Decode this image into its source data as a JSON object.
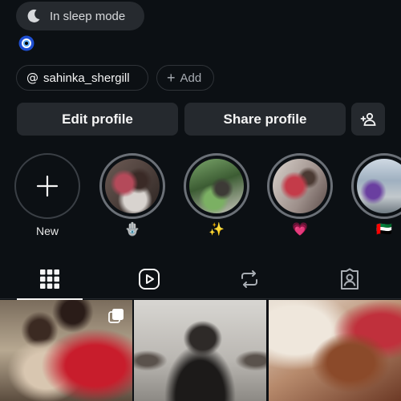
{
  "status": {
    "text": "In sleep mode",
    "icon": "moon-icon"
  },
  "bio_emoji": {
    "icon": "evil-eye-icon"
  },
  "links": {
    "threads_handle": "sahinka_shergill",
    "add_label": "Add"
  },
  "actions": {
    "edit_label": "Edit profile",
    "share_label": "Share profile",
    "add_friend_icon": "person-add-icon"
  },
  "highlights": {
    "new_label": "New",
    "items": [
      {
        "label": "🪬",
        "icon": "hamsa-emoji"
      },
      {
        "label": "✨",
        "icon": "sparkles-emoji"
      },
      {
        "label": "💗",
        "icon": "growing-heart-emoji"
      },
      {
        "label": "🇦🇪",
        "icon": "uae-flag-emoji"
      }
    ]
  },
  "tabs": [
    {
      "icon": "grid-icon",
      "active": true
    },
    {
      "icon": "reels-icon",
      "active": false
    },
    {
      "icon": "reposts-icon",
      "active": false
    },
    {
      "icon": "tagged-icon",
      "active": false
    }
  ],
  "colors": {
    "background": "#0c1014",
    "button": "#25292e",
    "text": "#f5f5f5"
  }
}
